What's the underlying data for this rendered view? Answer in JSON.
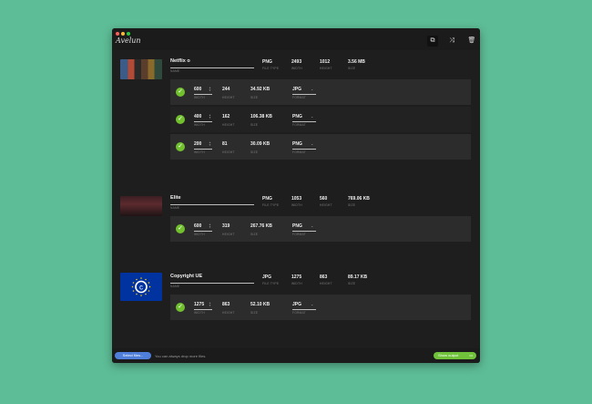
{
  "app": {
    "logo_text": "Avelun"
  },
  "window": {
    "traffic_lights": {
      "close": "#ff5f57",
      "minimize": "#febc2e",
      "maximize": "#28c840"
    },
    "toolbar": {
      "copy_icon": "copy-icon",
      "shuffle_icon": "shuffle-icon",
      "trash_icon": "trash-icon"
    }
  },
  "labels": {
    "name": "NAME",
    "file_type": "FILE TYPE",
    "width": "WIDTH",
    "height": "HEIGHT",
    "size": "SIZE",
    "format": "FORMAT"
  },
  "files": [
    {
      "name": "Netflix o",
      "type": "PNG",
      "width": "2493",
      "height": "1012",
      "size": "3.56 MB",
      "outputs": [
        {
          "width": "600",
          "height": "244",
          "size": "34.92 KB",
          "format": "JPG"
        },
        {
          "width": "400",
          "height": "162",
          "size": "106.38 KB",
          "format": "PNG"
        },
        {
          "width": "200",
          "height": "81",
          "size": "30.09 KB",
          "format": "PNG"
        }
      ]
    },
    {
      "name": "Elite",
      "type": "PNG",
      "width": "1053",
      "height": "560",
      "size": "769.06 KB",
      "outputs": [
        {
          "width": "600",
          "height": "319",
          "size": "267.76 KB",
          "format": "PNG"
        }
      ]
    },
    {
      "name": "Copyright UE",
      "type": "JPG",
      "width": "1275",
      "height": "863",
      "size": "89.17 KB",
      "outputs": [
        {
          "width": "1275",
          "height": "863",
          "size": "52.10 KB",
          "format": "JPG"
        }
      ]
    }
  ],
  "footer": {
    "select_label": "Select files...",
    "hint": "You can always drop more files.",
    "show_output_label": "Show output"
  },
  "colors": {
    "background": "#5dbd96",
    "accent_blue": "#4f7fd8",
    "accent_green": "#6fc23a"
  }
}
